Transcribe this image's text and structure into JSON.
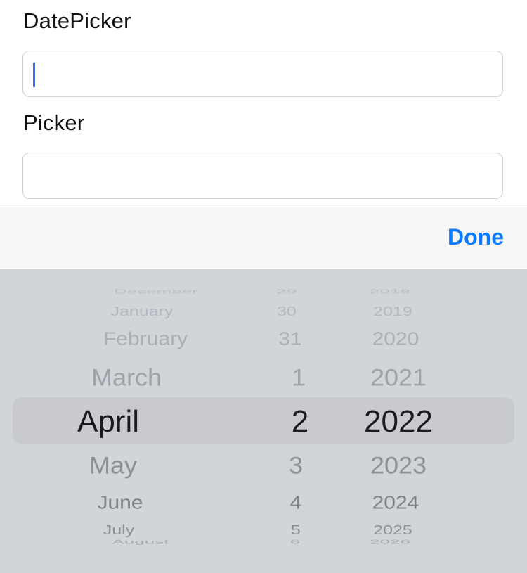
{
  "form": {
    "datepicker_label": "DatePicker",
    "datepicker_value": "",
    "picker_label": "Picker",
    "picker_value": ""
  },
  "toolbar": {
    "done_label": "Done",
    "accent_color": "#0a7aff"
  },
  "date_picker": {
    "months": [
      "December",
      "January",
      "February",
      "March",
      "April",
      "May",
      "June",
      "July",
      "August"
    ],
    "days": [
      "29",
      "30",
      "31",
      "1",
      "2",
      "3",
      "4",
      "5",
      "6"
    ],
    "years": [
      "2018",
      "2019",
      "2020",
      "2021",
      "2022",
      "2023",
      "2024",
      "2025",
      "2026"
    ],
    "selected": {
      "month": "April",
      "day": "2",
      "year": "2022"
    }
  }
}
